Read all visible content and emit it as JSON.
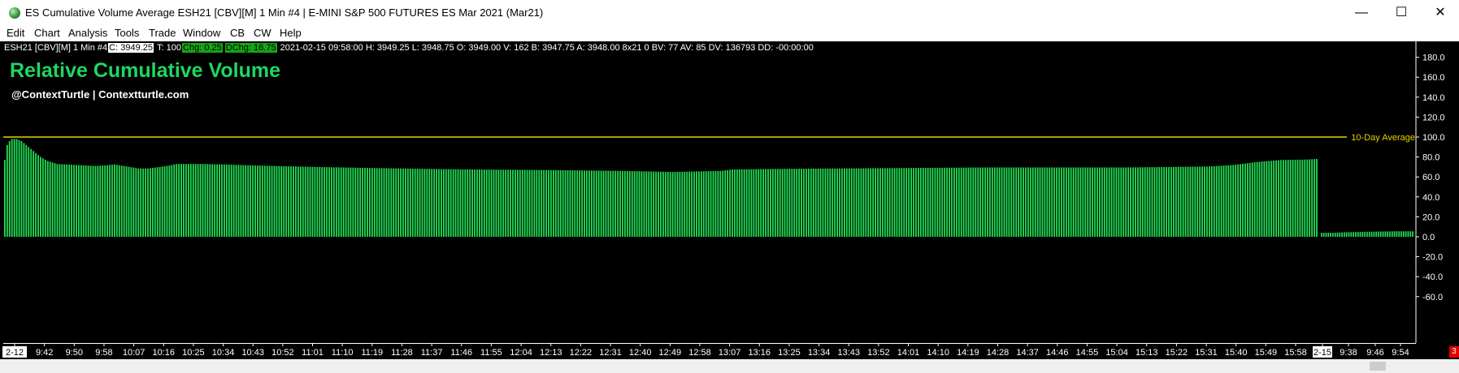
{
  "window": {
    "title": "ES Cumulative Volume Average ESH21 [CBV][M]  1 Min   #4 | E-MINI S&P 500 FUTURES ES Mar 2021 (Mar21)",
    "minimize": "—",
    "maximize": "☐",
    "close": "✕"
  },
  "menu": [
    "Edit",
    "Chart",
    "Analysis",
    "Tools",
    "Trade",
    "Window",
    "CB",
    "CW",
    "Help"
  ],
  "info_bar": {
    "symbol": "ESH21 [CBV][M]  1 Min   #4",
    "close": "C: 3949.25",
    "ticks": "T: 100",
    "chg": "Chg: 0.25",
    "dchg": "DChg: 16.75",
    "rest": "2021-02-15 09:58:00 H: 3949.25  L: 3948.75  O: 3949.00  V: 162  B: 3947.75  A: 3948.00  8x21  0  BV: 77  AV: 85  DV: 136793  DD: -00:00:00"
  },
  "chart_title": "Relative Cumulative Volume",
  "chart_subtitle": "@ContextTurtle | Contextturtle.com",
  "corner_badge": "3",
  "colors": {
    "bar": "#22dd55",
    "reference_line": "#e6d100",
    "title": "#1ed760",
    "axis_text": "#ffffff"
  },
  "chart_data": {
    "type": "bar",
    "y_ticks": [
      "180.0",
      "160.0",
      "140.0",
      "120.0",
      "100.0",
      "80.0",
      "60.0",
      "40.0",
      "20.0",
      "0.0",
      "-20.0",
      "-40.0",
      "-60.0"
    ],
    "ylim": [
      -60,
      190
    ],
    "reference_line": {
      "value": 100.0,
      "label": "10-Day Average"
    },
    "session1_x_labels": [
      "2-12",
      "9:42",
      "9:50",
      "9:58",
      "10:07",
      "10:16",
      "10:25",
      "10:34",
      "10:43",
      "10:52",
      "11:01",
      "11:10",
      "11:19",
      "11:28",
      "11:37",
      "11:46",
      "11:55",
      "12:04",
      "12:13",
      "12:22",
      "12:31",
      "12:40",
      "12:49",
      "12:58",
      "13:07",
      "13:16",
      "13:25",
      "13:34",
      "13:43",
      "13:52",
      "14:01",
      "14:10",
      "14:19",
      "14:28",
      "14:37",
      "14:46",
      "14:55",
      "15:04",
      "15:13",
      "15:22",
      "15:31",
      "15:40",
      "15:49",
      "15:58"
    ],
    "session2_x_labels": [
      "2-15",
      "9:38",
      "9:46",
      "9:54"
    ],
    "series": [
      {
        "session1_key_points": [
          [
            0,
            77
          ],
          [
            1,
            92
          ],
          [
            2,
            96
          ],
          [
            3,
            98
          ],
          [
            4,
            98
          ],
          [
            5,
            98
          ],
          [
            7,
            96
          ],
          [
            9,
            92
          ],
          [
            12,
            86
          ],
          [
            15,
            80
          ],
          [
            18,
            76
          ],
          [
            22,
            73
          ],
          [
            30,
            72
          ],
          [
            38,
            71
          ],
          [
            42,
            71.5
          ],
          [
            46,
            72.5
          ],
          [
            50,
            71
          ],
          [
            56,
            68.5
          ],
          [
            60,
            68.5
          ],
          [
            65,
            70
          ],
          [
            69,
            71.5
          ],
          [
            72,
            73
          ],
          [
            82,
            73
          ],
          [
            92,
            72.5
          ],
          [
            105,
            71.5
          ],
          [
            130,
            70
          ],
          [
            165,
            68.5
          ],
          [
            195,
            67.5
          ],
          [
            225,
            67
          ],
          [
            260,
            66
          ],
          [
            280,
            65
          ],
          [
            300,
            66
          ],
          [
            305,
            67.5
          ],
          [
            320,
            68
          ],
          [
            350,
            68.5
          ],
          [
            380,
            69
          ],
          [
            410,
            69.5
          ],
          [
            440,
            69.5
          ],
          [
            470,
            69.5
          ],
          [
            490,
            70
          ],
          [
            505,
            70.5
          ],
          [
            515,
            72
          ],
          [
            525,
            75
          ],
          [
            535,
            77
          ],
          [
            546,
            77.5
          ],
          [
            550,
            78
          ]
        ],
        "session2_key_points": [
          [
            0,
            4
          ],
          [
            5,
            4
          ],
          [
            10,
            4.5
          ],
          [
            20,
            5
          ],
          [
            32,
            5.5
          ],
          [
            40,
            5.5
          ]
        ]
      }
    ]
  }
}
